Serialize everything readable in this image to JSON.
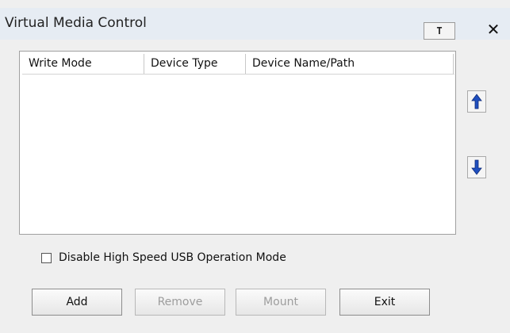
{
  "window": {
    "title": "Virtual Media Control",
    "pin_label": "T",
    "close_label": "✕"
  },
  "list": {
    "columns": [
      "Write Mode",
      "Device Type",
      "Device Name/Path"
    ],
    "rows": []
  },
  "side_buttons": {
    "move_up_icon": "arrow-up-icon",
    "move_down_icon": "arrow-down-icon"
  },
  "options": {
    "disable_high_speed_usb_label": "Disable High Speed USB Operation Mode",
    "disable_high_speed_usb_checked": false
  },
  "buttons": {
    "add": "Add",
    "remove": "Remove",
    "mount": "Mount",
    "exit": "Exit"
  },
  "colors": {
    "accent_arrow": "#1f4fbf"
  }
}
